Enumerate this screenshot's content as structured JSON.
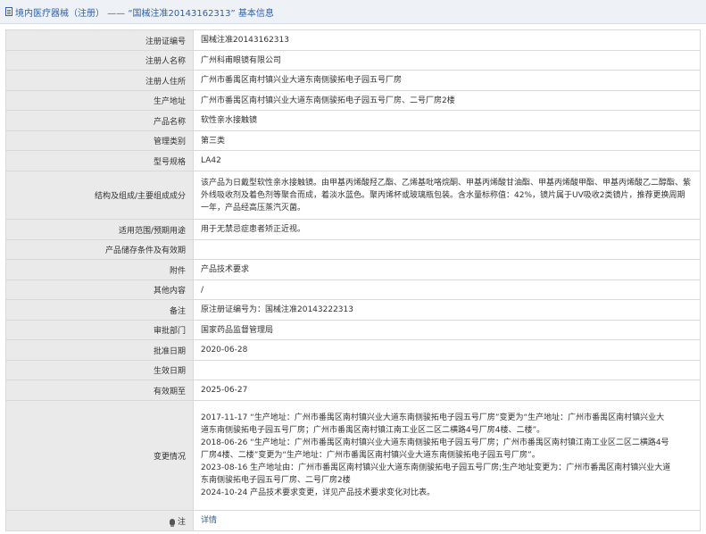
{
  "header": {
    "title": "境内医疗器械（注册） —— “国械注准20143162313” 基本信息"
  },
  "rows": [
    {
      "label": "注册证编号",
      "value": "国械注准20143162313"
    },
    {
      "label": "注册人名称",
      "value": "广州科甫眼镜有限公司"
    },
    {
      "label": "注册人住所",
      "value": "广州市番禺区南村镇兴业大道东南侧骏拓电子园五号厂房"
    },
    {
      "label": "生产地址",
      "value": "广州市番禺区南村镇兴业大道东南侧骏拓电子园五号厂房、二号厂房2楼"
    },
    {
      "label": "产品名称",
      "value": "软性亲水接触镜"
    },
    {
      "label": "管理类别",
      "value": "第三类"
    },
    {
      "label": "型号规格",
      "value": "LA42"
    },
    {
      "label": "结构及组成/主要组成成分",
      "value": "该产品为日戴型软性亲水接触镜。由甲基丙烯酸羟乙酯、乙烯基吡咯烷酮、甲基丙烯酸甘油酯、甲基丙烯酸甲酯、甲基丙烯酸乙二醇酯、紫外线吸收剂及着色剂等聚合而成，着淡水蓝色。聚丙烯杯或玻璃瓶包装。含水量标称值：42%，镜片属于UV吸收2类镜片，推荐更换周期一年，产品经高压蒸汽灭菌。"
    },
    {
      "label": "适用范围/预期用途",
      "value": "用于无禁忌症患者矫正近视。"
    },
    {
      "label": "产品储存条件及有效期",
      "value": ""
    },
    {
      "label": "附件",
      "value": "产品技术要求"
    },
    {
      "label": "其他内容",
      "value": "/"
    },
    {
      "label": "备注",
      "value": "原注册证编号为：国械注准20143222313"
    },
    {
      "label": "审批部门",
      "value": "国家药品监督管理局"
    },
    {
      "label": "批准日期",
      "value": "2020-06-28"
    },
    {
      "label": "生效日期",
      "value": ""
    },
    {
      "label": "有效期至",
      "value": "2025-06-27"
    }
  ],
  "changes": {
    "label": "变更情况",
    "lines": [
      "2017-11-17 “生产地址：广州市番禺区南村镇兴业大道东南侧骏拓电子园五号厂房”变更为“生产地址：广州市番禺区南村镇兴业大",
      "道东南侧骏拓电子园五号厂房；广州市番禺区南村镇江南工业区二区二横路4号厂房4楼、二楼”。",
      "2018-06-26 “生产地址：广州市番禺区南村镇兴业大道东南侧骏拓电子园五号厂房；广州市番禺区南村镇江南工业区二区二横路4号",
      "厂房4楼、二楼”变更为“生产地址：广州市番禺区南村镇兴业大道东南侧骏拓电子园五号厂房”。",
      "2023-08-16 生产地址由：广州市番禺区南村镇兴业大道东南侧骏拓电子园五号厂房;生产地址变更为：广州市番禺区南村镇兴业大道",
      "东南侧骏拓电子园五号厂房、二号厂房2楼",
      "2024-10-24 产品技术要求变更，详见产品技术要求变化对比表。"
    ]
  },
  "note": {
    "label": "注",
    "link": "详情"
  }
}
